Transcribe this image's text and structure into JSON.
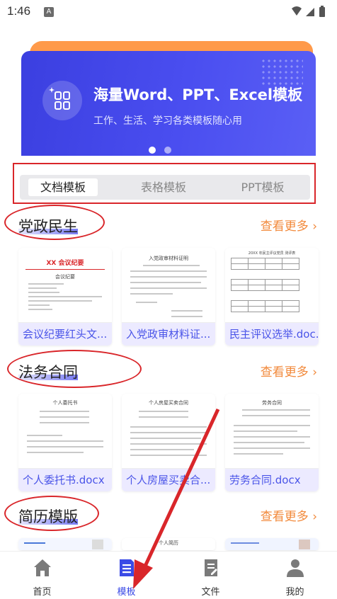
{
  "status_bar": {
    "time": "1:46",
    "notification_icon": "A"
  },
  "banner": {
    "title": "海量Word、PPT、Excel模板",
    "subtitle": "工作、生活、学习各类模板随心用",
    "page_count": 3,
    "active_page": 1
  },
  "tabs": [
    {
      "label": "文档模板",
      "active": true
    },
    {
      "label": "表格模板",
      "active": false
    },
    {
      "label": "PPT模板",
      "active": false
    }
  ],
  "sections": [
    {
      "title": "党政民生",
      "see_more": "查看更多 ›",
      "items": [
        {
          "name": "会议纪要红头文...",
          "doc_heading": "XX 会议纪要",
          "doc_subheading": "会议纪要"
        },
        {
          "name": "入党政审材料证...",
          "doc_heading": "入党政审材料证明"
        },
        {
          "name": "民主评议选举.doc...",
          "doc_heading": "20XX 年民主评议党员 测评表"
        }
      ]
    },
    {
      "title": "法务合同",
      "see_more": "查看更多 ›",
      "items": [
        {
          "name": "个人委托书.docx",
          "doc_heading": "个人委托书"
        },
        {
          "name": "个人房屋买卖合...",
          "doc_heading": "个人房屋买卖合同"
        },
        {
          "name": "劳务合同.docx",
          "doc_heading": "劳务合同"
        }
      ]
    },
    {
      "title": "简历模版",
      "see_more": "查看更多 ›",
      "items": [
        {
          "name": "",
          "doc_heading": ""
        },
        {
          "name": "",
          "doc_heading": "个人简历"
        },
        {
          "name": "",
          "doc_heading": ""
        }
      ]
    }
  ],
  "bottom_nav": [
    {
      "label": "首页",
      "icon": "home-icon",
      "active": false
    },
    {
      "label": "模板",
      "icon": "template-doc-icon",
      "active": true
    },
    {
      "label": "文件",
      "icon": "file-icon",
      "active": false
    },
    {
      "label": "我的",
      "icon": "user-icon",
      "active": false
    }
  ],
  "colors": {
    "accent": "#3a4ae6",
    "banner": "#4a4ef0",
    "banner_back": "#ff9a4a",
    "see_more": "#f28a3c",
    "annotation_red": "#d9262a",
    "caption_bg": "#eceaff"
  }
}
